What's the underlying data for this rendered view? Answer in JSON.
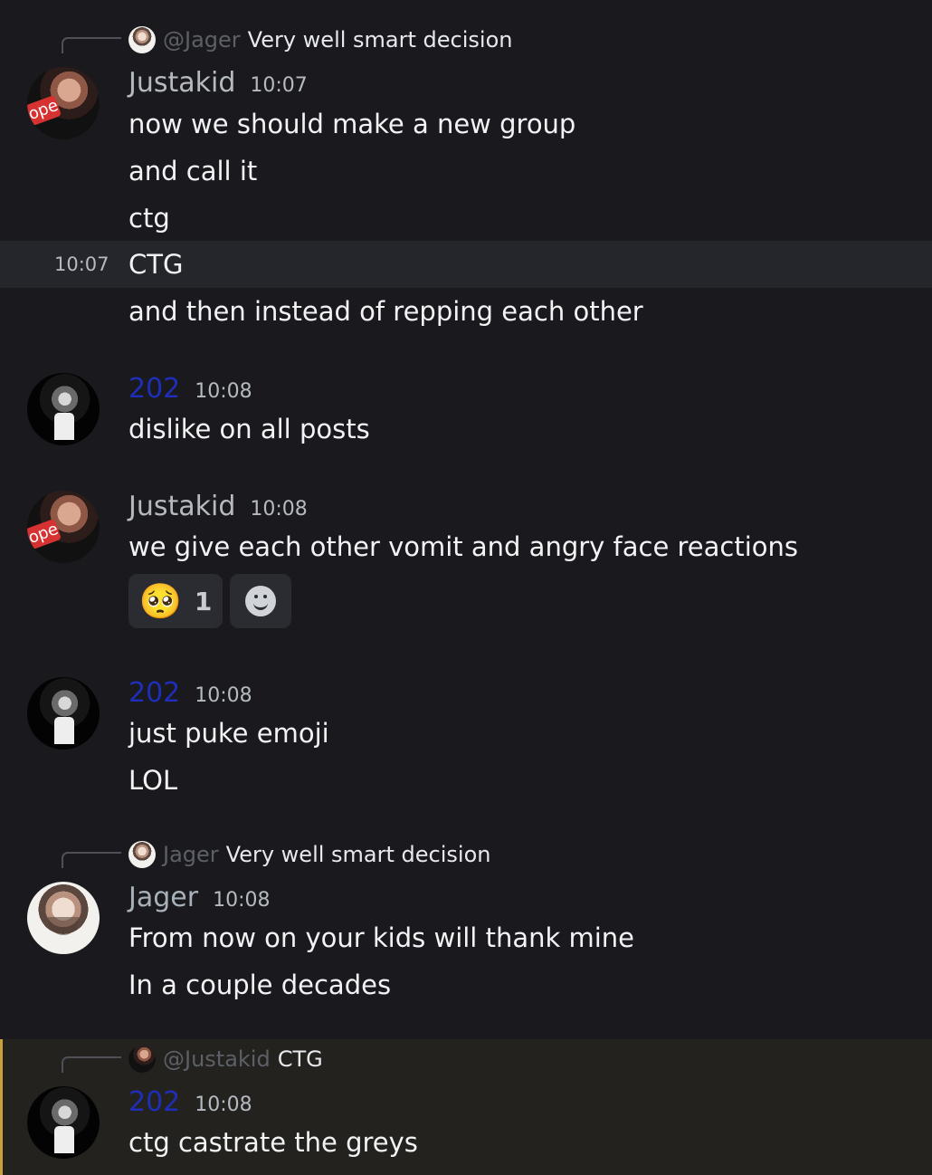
{
  "messages": [
    {
      "reply": {
        "author": "@Jager",
        "text": "Very well smart decision"
      },
      "author": "Justakid",
      "time": "10:07",
      "lines": [
        "now we should make a new group",
        "and call it",
        "ctg",
        "CTG",
        "and then instead of repping each other"
      ],
      "hover_time": "10:07",
      "avatar_stamp": "ope"
    },
    {
      "author": "202",
      "time": "10:08",
      "lines": [
        "dislike on all posts"
      ]
    },
    {
      "author": "Justakid",
      "time": "10:08",
      "lines": [
        "we give each other vomit and angry face reactions"
      ],
      "avatar_stamp": "ope",
      "reactions": [
        {
          "emoji": "🥺",
          "count": "1"
        }
      ]
    },
    {
      "author": "202",
      "time": "10:08",
      "lines": [
        "just puke emoji",
        "LOL"
      ]
    },
    {
      "reply": {
        "author": "Jager",
        "text": "Very well smart decision"
      },
      "author": "Jager",
      "time": "10:08",
      "lines": [
        "From now on your kids will thank mine",
        "In a couple decades"
      ]
    },
    {
      "reply": {
        "author": "@Justakid",
        "text": "CTG"
      },
      "author": "202",
      "time": "10:08",
      "lines": [
        "ctg castrate the greys"
      ],
      "highlighted": true
    }
  ],
  "icons": {
    "add_reaction": "smiley-icon"
  },
  "colors": {
    "background": "#1a1a1e",
    "hover_row": "#25262b",
    "mention_bg": "#24221f",
    "mention_bar": "#c9a13a",
    "author_202": "#1f2eb7"
  }
}
